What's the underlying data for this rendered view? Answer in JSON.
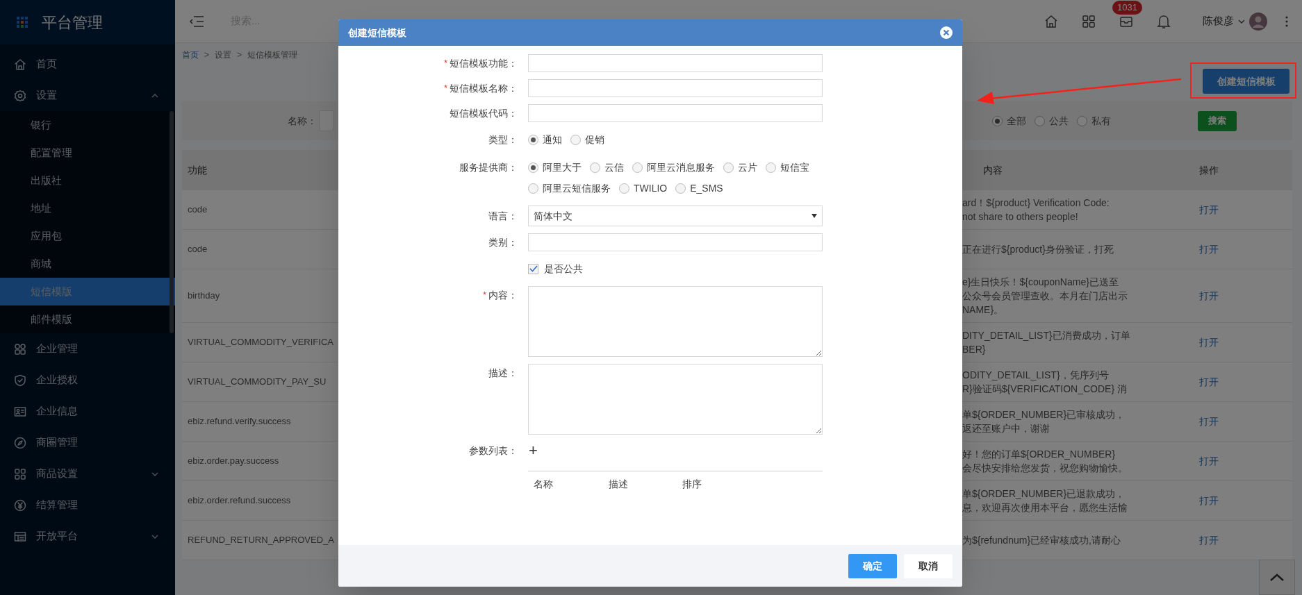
{
  "sidebar": {
    "title": "平台管理",
    "items": [
      {
        "label": "首页",
        "kind": "link"
      },
      {
        "label": "设置",
        "kind": "group",
        "expanded": true,
        "children": [
          {
            "label": "银行",
            "selected": false
          },
          {
            "label": "配置管理",
            "selected": false
          },
          {
            "label": "出版社",
            "selected": false
          },
          {
            "label": "地址",
            "selected": false
          },
          {
            "label": "应用包",
            "selected": false
          },
          {
            "label": "商城",
            "selected": false
          },
          {
            "label": "短信模版",
            "selected": true
          },
          {
            "label": "邮件模版",
            "selected": false
          }
        ]
      },
      {
        "label": "企业管理",
        "kind": "link"
      },
      {
        "label": "企业授权",
        "kind": "link"
      },
      {
        "label": "企业信息",
        "kind": "link"
      },
      {
        "label": "商圈管理",
        "kind": "link"
      },
      {
        "label": "商品设置",
        "kind": "group",
        "expanded": false
      },
      {
        "label": "结算管理",
        "kind": "link"
      },
      {
        "label": "开放平台",
        "kind": "group",
        "expanded": false
      }
    ]
  },
  "topbar": {
    "search": {
      "placeholder": "搜索..."
    },
    "badge": "1031",
    "user": "陈俊彦"
  },
  "breadcrumb": [
    {
      "label": "首页",
      "kind": "link"
    },
    {
      "label": ">",
      "kind": "separator"
    },
    {
      "label": "设置",
      "kind": "text"
    },
    {
      "label": ">",
      "kind": "separator"
    },
    {
      "label": "短信模板管理",
      "kind": "text"
    }
  ],
  "create_button": "创建短信模板",
  "filter": {
    "label": "名称：",
    "scope_options": [
      {
        "label": "全部",
        "selected": true
      },
      {
        "label": "公共",
        "selected": false
      },
      {
        "label": "私有",
        "selected": false
      }
    ],
    "search_button": "搜索"
  },
  "table": {
    "columns": [
      "功能",
      "内容",
      "操作"
    ],
    "rows": [
      {
        "function": "code",
        "content": [
          "ard！${product} Verification Code:",
          "not share to others people!"
        ],
        "action": "打开"
      },
      {
        "function": "code",
        "content": [
          "正在进行${product}身份验证，打死"
        ],
        "action": "打开"
      },
      {
        "function": "birthday",
        "content": [
          "e}生日快乐！${couponName}已送至",
          "公众号会员管理查收。本月在门店出示",
          "NAME}。"
        ],
        "action": "打开"
      },
      {
        "function": "VIRTUAL_COMMODITY_VERIFICA",
        "content": [
          "DITY_DETAIL_LIST}已消费成功，订单",
          "BER}"
        ],
        "action": "打开"
      },
      {
        "function": "VIRTUAL_COMMODITY_PAY_SU",
        "content": [
          "ODITY_DETAIL_LIST}，凭序列号",
          "R}验证码${VERIFICATION_CODE} 消"
        ],
        "action": "打开"
      },
      {
        "function": "ebiz.refund.verify.success",
        "content": [
          "单${ORDER_NUMBER}已审核成功，",
          "返还至账户中，谢谢"
        ],
        "action": "打开"
      },
      {
        "function": "ebiz.order.pay.success",
        "content": [
          "好！您的订单${ORDER_NUMBER}",
          "会尽快安排给您发货，祝您购物愉快。"
        ],
        "action": "打开"
      },
      {
        "function": "ebiz.order.refund.success",
        "content": [
          "单${ORDER_NUMBER}已退款成功，",
          "息，欢迎再次使用本平台，愿您生活愉"
        ],
        "action": "打开"
      },
      {
        "function": "REFUND_RETURN_APPROVED_A",
        "content": [
          "为${refundnum}已经审核成功,请耐心"
        ],
        "action": "打开"
      }
    ]
  },
  "modal": {
    "title": "创建短信模板",
    "fields": [
      {
        "kind": "text",
        "label": "短信模板功能：",
        "required_mark": "*"
      },
      {
        "kind": "text",
        "label": "短信模板名称：",
        "required_mark": "*"
      },
      {
        "kind": "text",
        "label": "短信模板代码："
      },
      {
        "kind": "radio",
        "label": "类型：",
        "options": [
          {
            "label": "通知",
            "selected": true
          },
          {
            "label": "促销",
            "selected": false
          }
        ]
      },
      {
        "kind": "radio",
        "label": "服务提供商：",
        "options": [
          {
            "label": "阿里大于",
            "selected": true
          },
          {
            "label": "云信",
            "selected": false
          },
          {
            "label": "阿里云消息服务",
            "selected": false
          },
          {
            "label": "云片",
            "selected": false
          },
          {
            "label": "短信宝",
            "selected": false
          },
          {
            "label": "阿里云短信服务",
            "selected": false
          },
          {
            "label": "TWILIO",
            "selected": false
          },
          {
            "label": "E_SMS",
            "selected": false
          }
        ]
      },
      {
        "kind": "select",
        "label": "语言：",
        "value": "简体中文"
      },
      {
        "kind": "text",
        "label": "类别："
      },
      {
        "kind": "checkbox",
        "text": "是否公共",
        "checked": true
      },
      {
        "kind": "textarea",
        "label": "内容：",
        "required_mark": "*"
      },
      {
        "kind": "textarea",
        "label": "描述："
      },
      {
        "kind": "params",
        "label": "参数列表：",
        "add": "+",
        "columns": [
          "名称",
          "描述",
          "排序"
        ]
      }
    ],
    "confirm_button": "确定",
    "cancel_button": "取消"
  }
}
